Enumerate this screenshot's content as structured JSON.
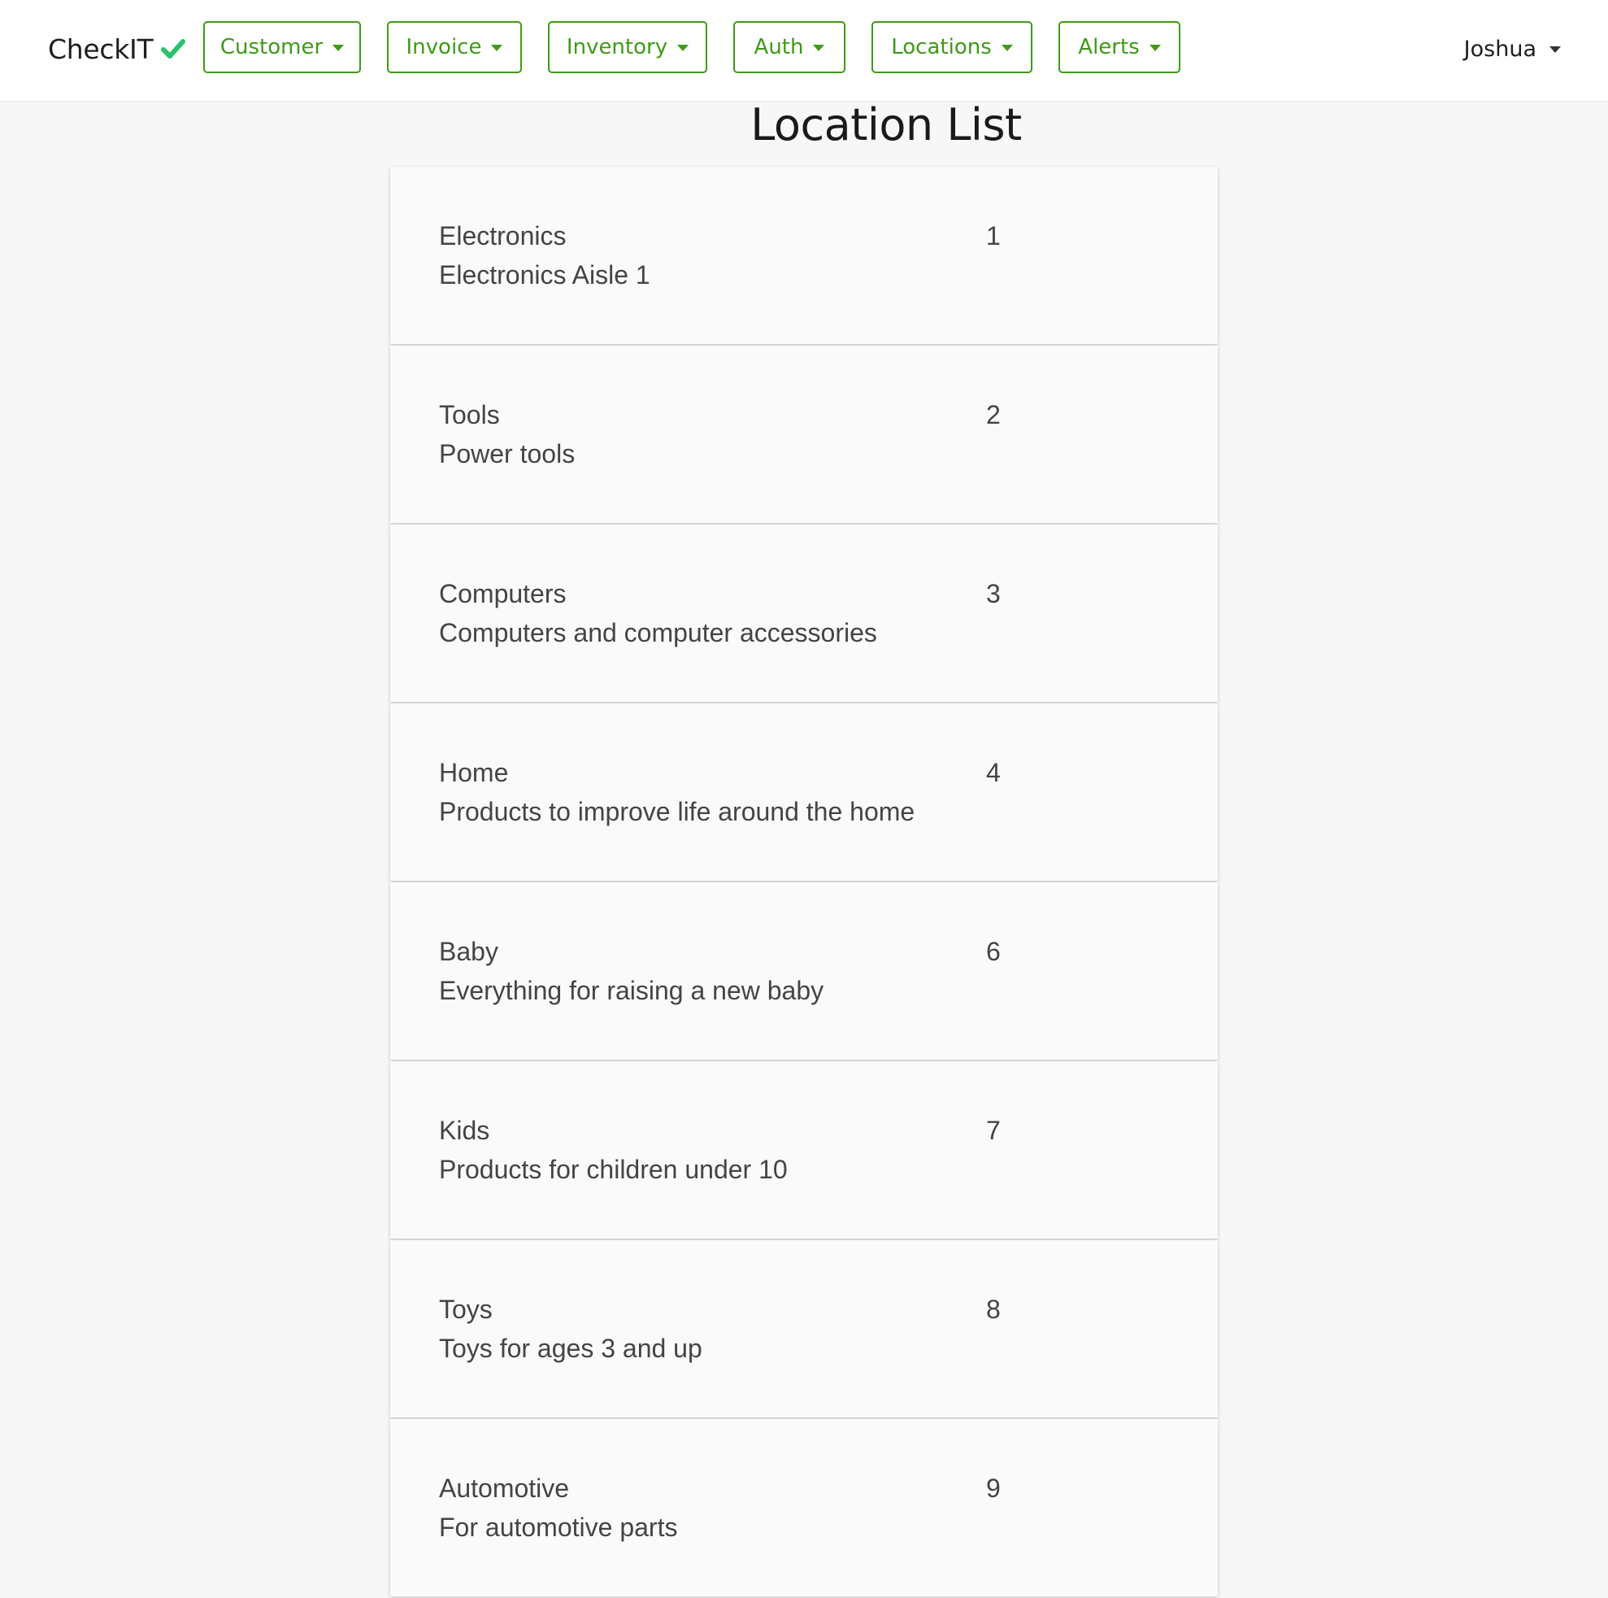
{
  "brand": {
    "name": "CheckIT",
    "icon": "checkmark-icon",
    "icon_color": "#27c26b"
  },
  "nav": {
    "accent_color": "#3e9a18",
    "menus": [
      {
        "label": "Customer"
      },
      {
        "label": "Invoice"
      },
      {
        "label": "Inventory"
      },
      {
        "label": "Auth"
      },
      {
        "label": "Locations"
      },
      {
        "label": "Alerts"
      }
    ]
  },
  "user": {
    "name": "Joshua"
  },
  "page": {
    "title": "Location List"
  },
  "locations": [
    {
      "name": "Electronics",
      "description": "Electronics Aisle 1",
      "id": "1"
    },
    {
      "name": "Tools",
      "description": "Power tools",
      "id": "2"
    },
    {
      "name": "Computers",
      "description": "Computers and computer accessories",
      "id": "3"
    },
    {
      "name": "Home",
      "description": "Products to improve life around the home",
      "id": "4"
    },
    {
      "name": "Baby",
      "description": "Everything for raising a new baby",
      "id": "6"
    },
    {
      "name": "Kids",
      "description": "Products for children under 10",
      "id": "7"
    },
    {
      "name": "Toys",
      "description": "Toys for ages 3 and up",
      "id": "8"
    },
    {
      "name": "Automotive",
      "description": "For automotive parts",
      "id": "9"
    }
  ]
}
